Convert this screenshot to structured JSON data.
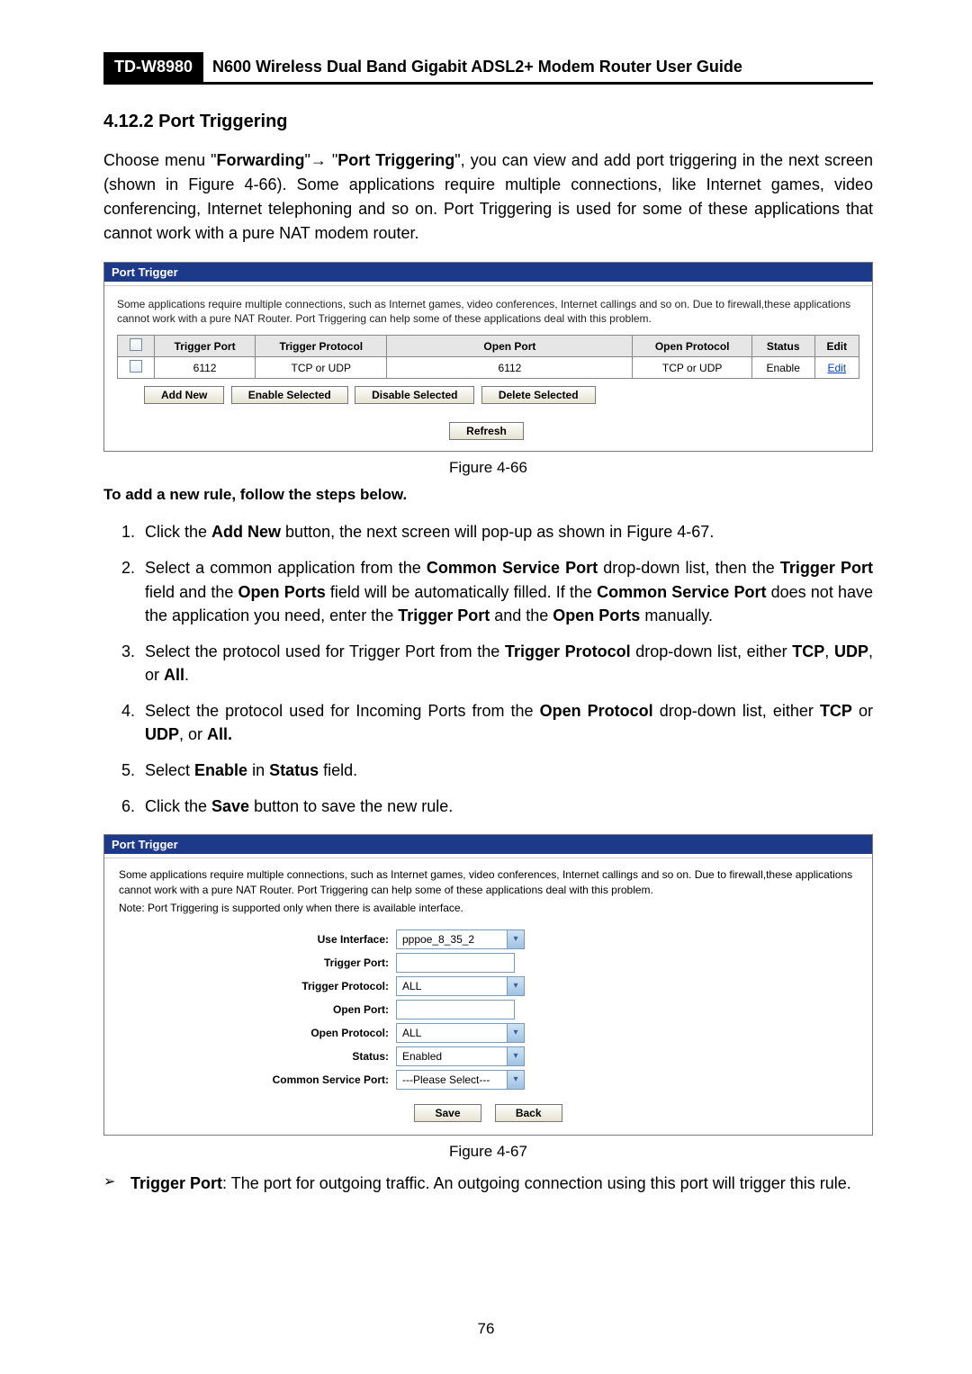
{
  "header": {
    "model": "TD-W8980",
    "title": "N600 Wireless Dual Band Gigabit ADSL2+ Modem Router User Guide"
  },
  "section": {
    "number": "4.12.2",
    "title": "Port Triggering"
  },
  "intro": {
    "pre": "Choose menu \"",
    "menu1": "Forwarding",
    "arrow": "\"→ \"",
    "menu2": "Port Triggering",
    "post": "\", you can view and add port triggering in the next screen (shown in Figure 4-66). Some applications require multiple connections, like Internet games, video conferencing, Internet telephoning and so on. Port Triggering is used for some of these applications that cannot work with a pure NAT modem router."
  },
  "fig1": {
    "panel_title": "Port Trigger",
    "note": "Some applications require multiple connections, such as Internet games, video conferences, Internet callings and so on. Due to firewall,these applications cannot work with a pure NAT Router. Port Triggering can help some of these applications deal with this problem.",
    "headers": {
      "check": "",
      "trigger_port": "Trigger Port",
      "trigger_proto": "Trigger Protocol",
      "open_port": "Open Port",
      "open_proto": "Open Protocol",
      "status": "Status",
      "edit": "Edit"
    },
    "row": {
      "trigger_port": "6112",
      "trigger_proto": "TCP or UDP",
      "open_port": "6112",
      "open_proto": "TCP or UDP",
      "status": "Enable",
      "edit": "Edit"
    },
    "buttons": {
      "add_new": "Add New",
      "enable_sel": "Enable Selected",
      "disable_sel": "Disable Selected",
      "delete_sel": "Delete Selected",
      "refresh": "Refresh"
    },
    "caption": "Figure 4-66"
  },
  "steps_title": "To add a new rule, follow the steps below.",
  "steps": [
    {
      "pre": "Click the ",
      "b1": "Add New",
      "post": " button, the next screen will pop-up as shown in Figure 4-67."
    },
    {
      "full_html": "Select a common application from the <b>Common Service Port</b> drop-down list, then the <b>Trigger Port</b> field and the <b>Open Ports</b> field will be automatically filled. If the <b>Common Service Port</b> does not have the application you need, enter the <b>Trigger Port</b> and the <b>Open Ports</b> manually."
    },
    {
      "full_html": "Select the protocol used for Trigger Port from the <b>Trigger Protocol</b> drop-down list, either <b>TCP</b>, <b>UDP</b>, or <b>All</b>."
    },
    {
      "full_html": "Select the protocol used for Incoming Ports from the <b>Open Protocol</b> drop-down list, either <b>TCP</b> or <b>UDP</b>, or <b>All.</b>"
    },
    {
      "full_html": "Select <b>Enable</b> in <b>Status</b> field."
    },
    {
      "full_html": "Click the <b>Save</b> button to save the new rule."
    }
  ],
  "fig2": {
    "panel_title": "Port Trigger",
    "note1": "Some applications require multiple connections, such as Internet games, video conferences, Internet callings and so on. Due to firewall,these applications cannot work with a pure NAT Router. Port Triggering can help some of these applications deal with this problem.",
    "note2": "Note: Port Triggering is supported only when there is available interface.",
    "fields": {
      "use_interface": {
        "label": "Use Interface:",
        "value": "pppoe_8_35_2"
      },
      "trigger_port": {
        "label": "Trigger Port:",
        "value": ""
      },
      "trigger_proto": {
        "label": "Trigger Protocol:",
        "value": "ALL"
      },
      "open_port": {
        "label": "Open Port:",
        "value": ""
      },
      "open_proto": {
        "label": "Open Protocol:",
        "value": "ALL"
      },
      "status": {
        "label": "Status:",
        "value": "Enabled"
      },
      "csp": {
        "label": "Common Service Port:",
        "value": "---Please Select---"
      }
    },
    "buttons": {
      "save": "Save",
      "back": "Back"
    },
    "caption": "Figure 4-67"
  },
  "bullet": {
    "term": "Trigger Port",
    "text": ": The port for outgoing traffic. An outgoing connection using this port will trigger this rule."
  },
  "page_number": "76"
}
